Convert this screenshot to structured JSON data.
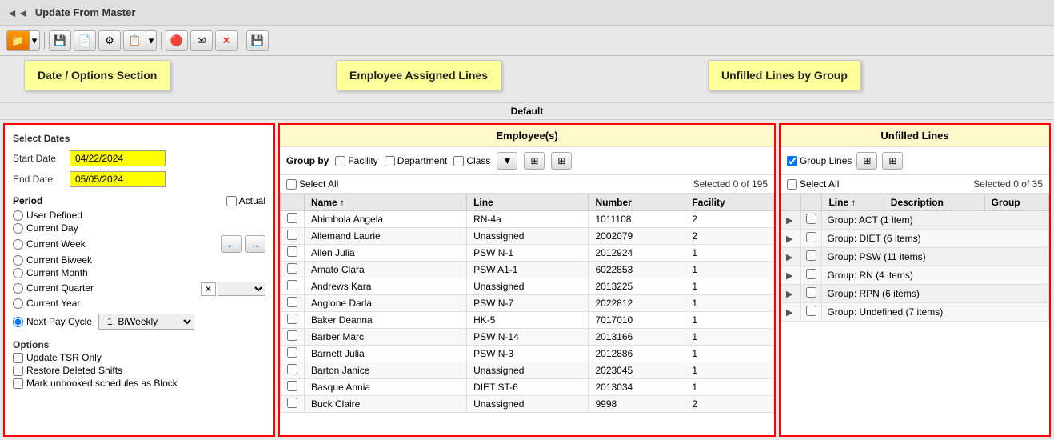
{
  "titleBar": {
    "title": "Update From Master",
    "arrows": "◄◄"
  },
  "toolbar": {
    "buttons": [
      "📁",
      "💾",
      "📄",
      "⚙",
      "📋",
      "🔴",
      "✉",
      "✕",
      "💾"
    ]
  },
  "floatingLabels": {
    "employee": "Employee Assigned Lines",
    "unfilled": "Unfilled Lines by Group",
    "dateOptions": "Date / Options Section"
  },
  "defaultLabel": "Default",
  "leftPanel": {
    "selectDatesTitle": "Select Dates",
    "startDateLabel": "Start Date",
    "startDateValue": "04/22/2024",
    "endDateLabel": "End Date",
    "endDateValue": "05/05/2024",
    "periodTitle": "Period",
    "actualLabel": "Actual",
    "periodOptions": [
      "User Defined",
      "Current Day",
      "Current Week",
      "Current Biweek",
      "Current Month",
      "Current Quarter",
      "Current Year"
    ],
    "nextPayCycleLabel": "Next Pay Cycle",
    "payCycleValue": "1. BiWeekly",
    "optionsTitle": "Options",
    "optionsList": [
      "Update TSR Only",
      "Restore Deleted Shifts",
      "Mark unbooked schedules as Block"
    ]
  },
  "middlePanel": {
    "title": "Employee(s)",
    "groupByLabel": "Group by",
    "groupByOptions": [
      "Facility",
      "Department",
      "Class"
    ],
    "selectAllLabel": "Select All",
    "selectedCount": "Selected 0 of 195",
    "columns": [
      "Name ↑",
      "Line",
      "Number",
      "Facility"
    ],
    "employees": [
      {
        "name": "Abimbola Angela",
        "line": "RN-4a",
        "number": "1011108",
        "facility": "2"
      },
      {
        "name": "Allemand Laurie",
        "line": "Unassigned",
        "number": "2002079",
        "facility": "2"
      },
      {
        "name": "Allen Julia",
        "line": "PSW N-1",
        "number": "2012924",
        "facility": "1"
      },
      {
        "name": "Amato Clara",
        "line": "PSW A1-1",
        "number": "6022853",
        "facility": "1"
      },
      {
        "name": "Andrews Kara",
        "line": "Unassigned",
        "number": "2013225",
        "facility": "1"
      },
      {
        "name": "Angione Darla",
        "line": "PSW N-7",
        "number": "2022812",
        "facility": "1"
      },
      {
        "name": "Baker Deanna",
        "line": "HK-5",
        "number": "7017010",
        "facility": "1"
      },
      {
        "name": "Barber Marc",
        "line": "PSW N-14",
        "number": "2013166",
        "facility": "1"
      },
      {
        "name": "Barnett Julia",
        "line": "PSW N-3",
        "number": "2012886",
        "facility": "1"
      },
      {
        "name": "Barton Janice",
        "line": "Unassigned",
        "number": "2023045",
        "facility": "1"
      },
      {
        "name": "Basque Annia",
        "line": "DIET ST-6",
        "number": "2013034",
        "facility": "1"
      },
      {
        "name": "Buck Claire",
        "line": "Unassigned",
        "number": "9998",
        "facility": "2"
      }
    ]
  },
  "rightPanel": {
    "title": "Unfilled Lines",
    "groupLinesLabel": "Group Lines",
    "selectAllLabel": "Select All",
    "selectedCount": "Selected 0 of 35",
    "columns": [
      "Line ↑",
      "Description",
      "Group"
    ],
    "groups": [
      {
        "name": "Group: ACT (1 item)"
      },
      {
        "name": "Group: DIET (6 items)"
      },
      {
        "name": "Group: PSW (11 items)"
      },
      {
        "name": "Group: RN (4 items)"
      },
      {
        "name": "Group: RPN (6 items)"
      },
      {
        "name": "Group: Undefined (7 items)"
      }
    ]
  }
}
